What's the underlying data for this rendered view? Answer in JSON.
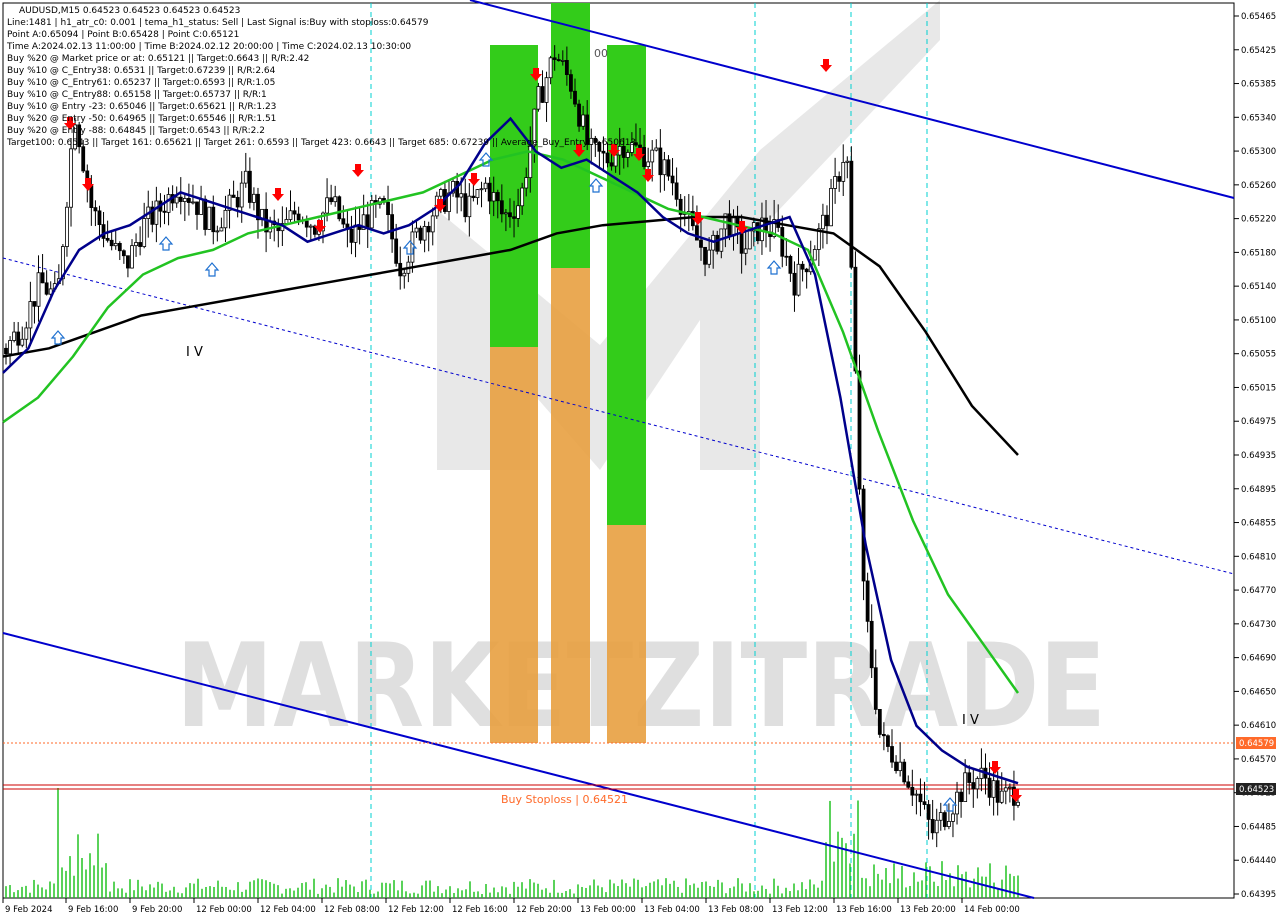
{
  "window": {
    "title": "AUDUSD,M15 0.64523 0.64523 0.64523 0.64523"
  },
  "info_lines": [
    "AUDUSD,M15 0.64523 0.64523 0.64523 0.64523",
    "Line:1481 | h1_atr_c0: 0.001 | tema_h1_status: Sell | Last Signal is:Buy with stoploss:0.64579",
    "Point A:0.65094 | Point B:0.65428 | Point C:0.65121",
    "Time A:2024.02.13 11:00:00 | Time B:2024.02.12 20:00:00 | Time C:2024.02.13 10:30:00",
    "Buy %20 @ Market price or at: 0.65121 || Target:0.6643 || R/R:2.42",
    "Buy %10 @ C_Entry38: 0.6531 || Target:0.67239 || R/R:2.64",
    "Buy %10 @ C_Entry61: 0.65237 || Target:0.6593 || R/R:1.05",
    "Buy %10 @ C_Entry88: 0.65158 || Target:0.65737 || R/R:1",
    "Buy %10 @ Entry -23: 0.65046 || Target:0.65621 || R/R:1.23",
    "Buy %20 @ Entry -50: 0.64965 || Target:0.65546 || R/R:1.51",
    "Buy %20 @ Entry -88: 0.64845 || Target:0.6543 || R/R:2.2",
    "Target100: 0.6543 || Target 161: 0.65621 || Target 261: 0.6593 || Target 423: 0.6643 || Target 685: 0.67239 || Average_Buy_Entry: 0.650613"
  ],
  "watermark": {
    "text": "MARKETZITRADE"
  },
  "annotations": {
    "wave_label_left": "I V",
    "wave_label_right": "I V",
    "top_partial_label": "00",
    "stoploss_label": "Buy Stoploss | 0.64521"
  },
  "price_tags": [
    {
      "label": "0.64579",
      "color": "#ff6a2a"
    },
    {
      "label": "0.64523",
      "color": "#222222"
    }
  ],
  "colors": {
    "background": "#ffffff",
    "bull_candle": "#000000",
    "bear_candle": "#000000",
    "fast_ma": "#00008b",
    "mid_ma": "#22c322",
    "slow_ma": "#000000",
    "channel": "#0000cd",
    "session_line": "#00d0d0",
    "stoploss_line": "#ff6a2a",
    "price_line": "#cc0000",
    "volume": "#22c322",
    "zone_green": "#33cc1a",
    "zone_orange": "#e8a040",
    "sell_arrow": "#ff0000",
    "buy_arrow": "#1e70d0",
    "watermark": "#000000"
  },
  "chart_data": {
    "type": "line",
    "symbol": "AUDUSD",
    "timeframe": "M15",
    "yaxis_ticks": [
      "0.65465",
      "0.65425",
      "0.65385",
      "0.65340",
      "0.65300",
      "0.65260",
      "0.65220",
      "0.65180",
      "0.65140",
      "0.65100",
      "0.65055",
      "0.65015",
      "0.64975",
      "0.64935",
      "0.64895",
      "0.64855",
      "0.64810",
      "0.64770",
      "0.64730",
      "0.64690",
      "0.64650",
      "0.64610",
      "0.64570",
      "0.64525",
      "0.64485",
      "0.64440",
      "0.64395"
    ],
    "ylim": [
      0.6438,
      0.6548
    ],
    "xaxis_ticks": [
      "9 Feb 2024",
      "9 Feb 16:00",
      "9 Feb 20:00",
      "12 Feb 00:00",
      "12 Feb 04:00",
      "12 Feb 08:00",
      "12 Feb 12:00",
      "12 Feb 16:00",
      "12 Feb 20:00",
      "13 Feb 00:00",
      "13 Feb 04:00",
      "13 Feb 08:00",
      "13 Feb 12:00",
      "13 Feb 16:00",
      "13 Feb 20:00",
      "14 Feb 00:00"
    ],
    "levels": {
      "stoploss": 0.64579,
      "current_price": 0.64523,
      "point_a": 0.65094,
      "point_b": 0.65428,
      "point_c": 0.65121
    },
    "close_series": [
      0.6506,
      0.6509,
      0.6514,
      0.6512,
      0.6535,
      0.6523,
      0.6519,
      0.6516,
      0.6521,
      0.6523,
      0.6526,
      0.6524,
      0.6521,
      0.6523,
      0.6526,
      0.6521,
      0.652,
      0.6523,
      0.6521,
      0.6524,
      0.6519,
      0.6522,
      0.6523,
      0.6516,
      0.652,
      0.6523,
      0.6525,
      0.6523,
      0.6526,
      0.6522,
      0.6524,
      0.6536,
      0.6542,
      0.6538,
      0.653,
      0.6529,
      0.6531,
      0.653,
      0.6529,
      0.6526,
      0.652,
      0.6517,
      0.6522,
      0.6518,
      0.6521,
      0.652,
      0.6514,
      0.6518,
      0.6523,
      0.6531,
      0.6476,
      0.6458,
      0.6456,
      0.6452,
      0.6447,
      0.645,
      0.6453,
      0.6454,
      0.6451,
      0.64523
    ],
    "fast_ma": [
      0.6503,
      0.6506,
      0.6513,
      0.6518,
      0.652,
      0.6521,
      0.6523,
      0.6525,
      0.6524,
      0.6523,
      0.6522,
      0.6521,
      0.6519,
      0.652,
      0.6521,
      0.652,
      0.6521,
      0.6523,
      0.6526,
      0.6531,
      0.6534,
      0.653,
      0.6528,
      0.6529,
      0.6527,
      0.6525,
      0.6522,
      0.652,
      0.6519,
      0.652,
      0.6521,
      0.6522,
      0.6515,
      0.65,
      0.6482,
      0.6468,
      0.646,
      0.6457,
      0.6455,
      0.6454,
      0.6453
    ],
    "mid_ma": [
      0.6497,
      0.65,
      0.6505,
      0.6511,
      0.6515,
      0.6517,
      0.6518,
      0.652,
      0.6521,
      0.6522,
      0.6523,
      0.6524,
      0.6525,
      0.6527,
      0.6529,
      0.653,
      0.6529,
      0.6527,
      0.6525,
      0.6523,
      0.6522,
      0.6521,
      0.652,
      0.6518,
      0.6508,
      0.6496,
      0.6485,
      0.6476,
      0.647,
      0.6464
    ],
    "slow_ma": [
      0.6505,
      0.6506,
      0.6508,
      0.651,
      0.6511,
      0.6512,
      0.6513,
      0.6514,
      0.6515,
      0.6516,
      0.6517,
      0.6518,
      0.652,
      0.6521,
      0.65215,
      0.6522,
      0.6522,
      0.6521,
      0.652,
      0.6516,
      0.6508,
      0.6499,
      0.6493
    ],
    "volume": "relative bar heights, peak at session open",
    "grid": false,
    "legend": "none"
  }
}
